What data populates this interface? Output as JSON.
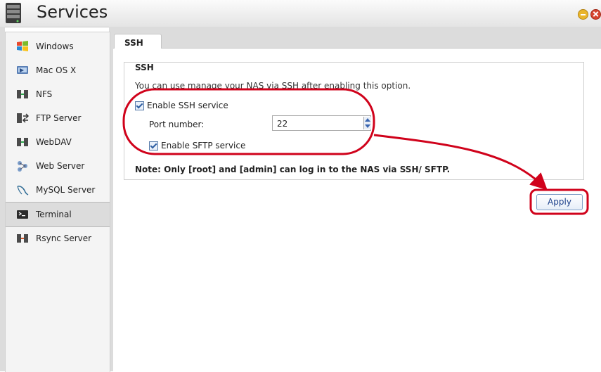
{
  "window": {
    "title": "Services",
    "app_icon": "server-icon",
    "minimize_icon": "minimize-icon",
    "close_icon": "close-icon"
  },
  "sidebar": {
    "items": [
      {
        "label": "Windows",
        "icon": "windows-icon"
      },
      {
        "label": "Mac OS X",
        "icon": "mac-icon"
      },
      {
        "label": "NFS",
        "icon": "nfs-icon"
      },
      {
        "label": "FTP Server",
        "icon": "ftp-icon"
      },
      {
        "label": "WebDAV",
        "icon": "webdav-icon"
      },
      {
        "label": "Web Server",
        "icon": "web-server-icon"
      },
      {
        "label": "MySQL Server",
        "icon": "mysql-icon"
      },
      {
        "label": "Terminal",
        "icon": "terminal-icon",
        "active": true
      },
      {
        "label": "Rsync Server",
        "icon": "rsync-icon"
      }
    ]
  },
  "tabs": [
    {
      "label": "SSH",
      "active": true
    }
  ],
  "ssh": {
    "legend": "SSH",
    "description": "You can use manage your NAS via SSH after enabling this option.",
    "enable_ssh_label": "Enable SSH service",
    "enable_ssh_checked": true,
    "port_label": "Port number:",
    "port_value": "22",
    "enable_sftp_label": "Enable SFTP service",
    "enable_sftp_checked": true,
    "note": "Note: Only [root] and [admin] can log in to the NAS via SSH/ SFTP."
  },
  "actions": {
    "apply_label": "Apply"
  },
  "colors": {
    "annotation": "#d0021b",
    "link_blue": "#1a3f8a"
  }
}
